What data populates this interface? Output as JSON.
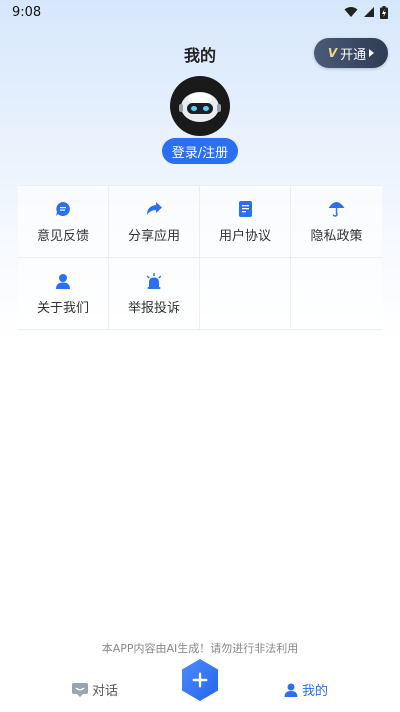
{
  "status_bar": {
    "time": "9:08"
  },
  "header": {
    "title": "我的"
  },
  "vip": {
    "label": "开通",
    "icon": "vip-icon",
    "icon_text": "V"
  },
  "login": {
    "label": "登录/注册"
  },
  "menu": [
    {
      "label": "意见反馈",
      "icon": "feedback-icon"
    },
    {
      "label": "分享应用",
      "icon": "share-icon"
    },
    {
      "label": "用户协议",
      "icon": "document-icon"
    },
    {
      "label": "隐私政策",
      "icon": "umbrella-icon"
    },
    {
      "label": "关于我们",
      "icon": "person-icon"
    },
    {
      "label": "举报投诉",
      "icon": "alarm-icon"
    }
  ],
  "disclaimer": "本APP内容由AI生成！请勿进行非法利用",
  "tabs": {
    "dialog": {
      "label": "对话",
      "icon": "chat-icon"
    },
    "add": {
      "icon": "plus-icon"
    },
    "mine": {
      "label": "我的",
      "icon": "person-icon"
    }
  },
  "colors": {
    "accent": "#2b6ff2",
    "vip_bg": "#3a4866",
    "vip_text": "#f2d58c"
  }
}
